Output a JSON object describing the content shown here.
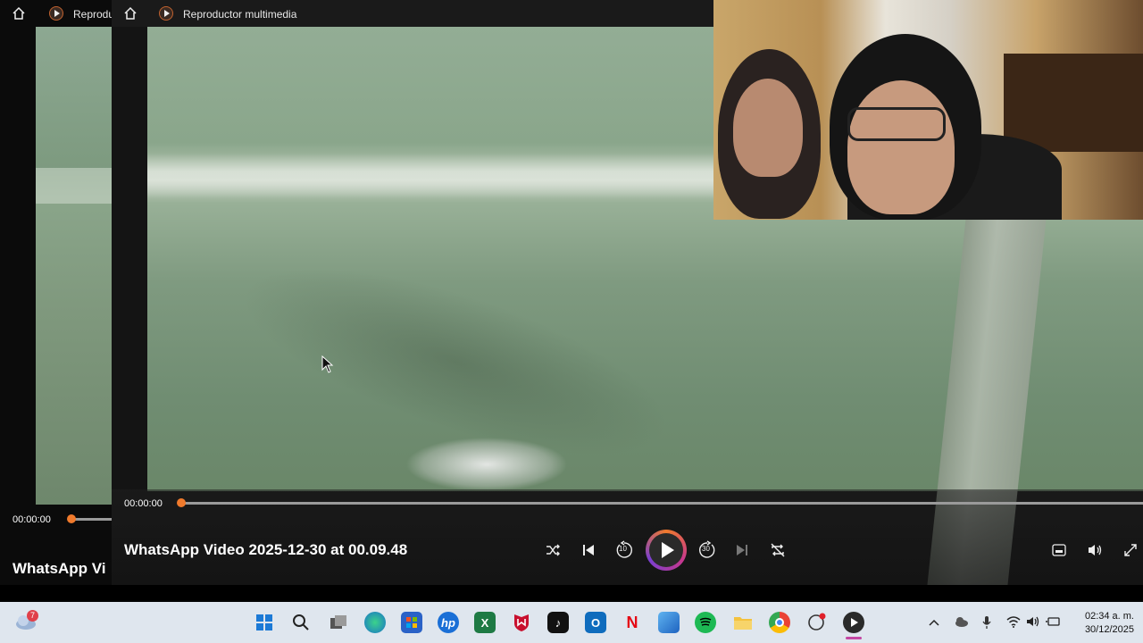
{
  "back_window": {
    "title": "Reproductor multimedia",
    "title_truncated": "Reprodu",
    "time": "00:00:00",
    "video_title_truncated": "WhatsApp Vi"
  },
  "front_window": {
    "title": "Reproductor multimedia",
    "time": "00:00:00",
    "video_title": "WhatsApp Video 2025-12-30 at 00.09.48",
    "progress_fraction": 0.0
  },
  "controls": {
    "shuffle_icon": "shuffle-icon",
    "previous_icon": "previous-icon",
    "rewind_label": "10",
    "play_icon": "play-icon",
    "forward_label": "30",
    "next_icon": "next-icon",
    "repeat_icon": "repeat-off-icon",
    "miniplayer_icon": "miniplayer-icon",
    "volume_icon": "volume-icon",
    "fullscreen_icon": "fullscreen-icon"
  },
  "taskbar": {
    "weather_badge": "7",
    "apps": [
      "windows-start",
      "search",
      "task-view",
      "edge",
      "store",
      "hp",
      "excel",
      "mcafee",
      "tiktok",
      "outlook",
      "netflix",
      "photos",
      "spotify",
      "file-explorer",
      "chrome",
      "copilot",
      "media-player"
    ],
    "clock_time": "02:34 a. m.",
    "clock_date": "30/12/2025"
  },
  "colors": {
    "accent": "#f07a2c",
    "taskbar_bg": "#dfe6ee"
  }
}
